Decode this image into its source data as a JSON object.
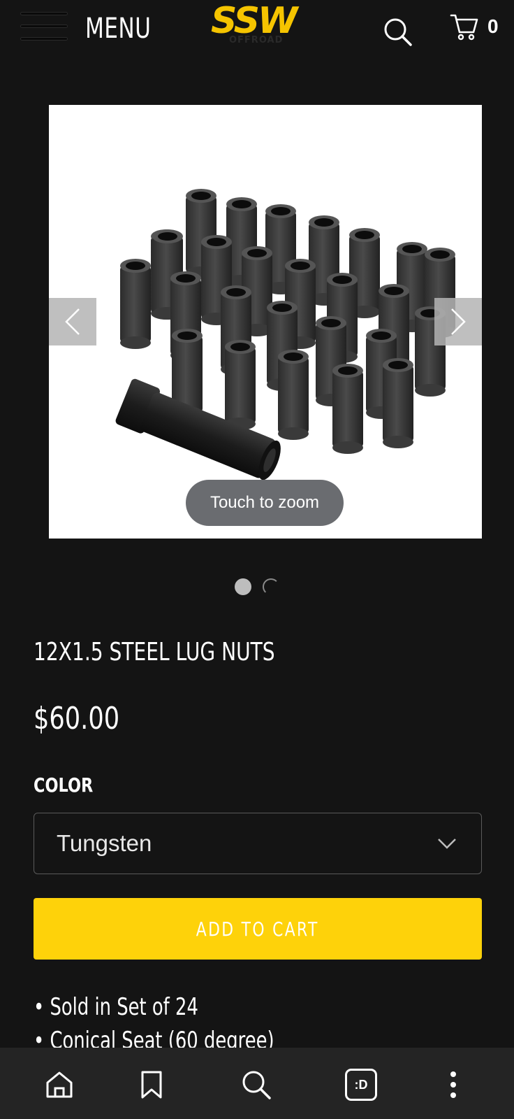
{
  "header": {
    "menu_label": "MENU",
    "logo_text": "SSW",
    "logo_subtext": "OFFROAD",
    "cart_count": "0"
  },
  "icons": {
    "menu": "hamburger-icon",
    "search": "search-icon",
    "cart": "cart-icon",
    "prev": "chevron-left-icon",
    "next": "chevron-right-icon",
    "select": "chevron-down-icon",
    "home": "home-icon",
    "bookmark": "bookmark-icon",
    "nav_search": "search-icon",
    "tabs": "tab-switcher-icon",
    "more": "more-vertical-icon"
  },
  "product": {
    "zoom_hint": "Touch to zoom",
    "title": "12X1.5 STEEL LUG NUTS",
    "price": "$60.00",
    "color_label": "COLOR",
    "color_value": "Tungsten",
    "add_to_cart": "ADD TO CART",
    "bullets": [
      "• Sold in Set of 24",
      "• Conical Seat (60 degree)"
    ]
  },
  "nav": {
    "tabs_label": ":D"
  },
  "colors": {
    "background": "#141414",
    "accent": "#fed20a",
    "nav_bar": "#242424"
  }
}
